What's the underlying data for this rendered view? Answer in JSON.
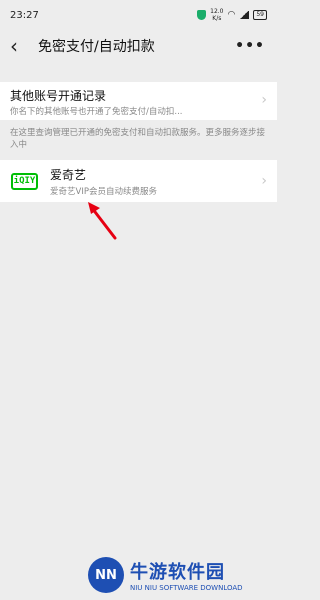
{
  "status_bar": {
    "time": "23:27",
    "net_speed_value": "12.0",
    "net_speed_unit": "K/s",
    "battery": "59"
  },
  "header": {
    "title": "免密支付/自动扣款",
    "back_icon": "chevron-left-icon",
    "more_icon": "more-dots-icon"
  },
  "other_accounts": {
    "title": "其他账号开通记录",
    "subtitle": "你名下的其他账号也开通了免密支付/自动扣..."
  },
  "info_text": "在这里查询管理已开通的免密支付和自动扣款服务。更多服务逐步接入中",
  "services": [
    {
      "name": "爱奇艺",
      "description": "爱奇艺VIP会员自动续费服务",
      "logo_text": "iQIY",
      "logo_color": "#00be06"
    }
  ],
  "watermark": {
    "logo_text": "NN",
    "cn": "牛游软件园",
    "en": "NIU NIU SOFTWARE DOWNLOAD"
  },
  "colors": {
    "background": "#ededed",
    "annotation_arrow": "#e60012",
    "watermark": "#1e4fb3"
  }
}
